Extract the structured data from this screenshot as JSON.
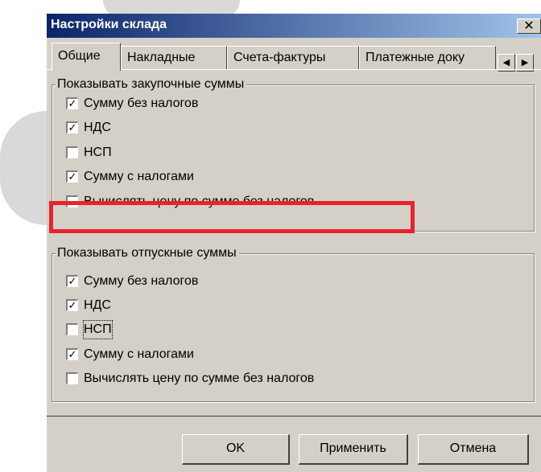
{
  "window": {
    "title": "Настройки склада",
    "close_glyph": "✕"
  },
  "tabs": [
    {
      "label": "Общие",
      "active": true
    },
    {
      "label": "Накладные",
      "active": false
    },
    {
      "label": "Счета-фактуры",
      "active": false
    },
    {
      "label": "Платежные доку",
      "active": false
    }
  ],
  "tab_scroll": {
    "left_glyph": "◀",
    "right_glyph": "▶"
  },
  "purchase_group": {
    "legend": "Показывать закупочные суммы",
    "items": [
      {
        "label": "Сумму без налогов",
        "mark": "✓",
        "checked": true
      },
      {
        "label": "НДС",
        "mark": "✓",
        "checked": true
      },
      {
        "label": "НСП",
        "mark": "",
        "checked": false
      },
      {
        "label": "Сумму с налогами",
        "mark": "✓",
        "checked": true
      },
      {
        "label": "Вычислять цену по сумме без налогов",
        "mark": "",
        "checked": false
      }
    ]
  },
  "sale_group": {
    "legend": "Показывать отпускные суммы",
    "items": [
      {
        "label": "Сумму без налогов",
        "mark": "✓",
        "checked": true
      },
      {
        "label": "НДС",
        "mark": "✓",
        "checked": true
      },
      {
        "label": "НСП",
        "mark": "",
        "checked": false
      },
      {
        "label": "Сумму с налогами",
        "mark": "✓",
        "checked": true
      },
      {
        "label": "Вычислять цену по сумме без налогов",
        "mark": "",
        "checked": false
      }
    ]
  },
  "buttons": {
    "ok": "OK",
    "apply": "Применить",
    "cancel": "Отмена"
  },
  "colors": {
    "highlight": "#e8232a",
    "titlebar_start": "#0a246a",
    "titlebar_end": "#a6caf0",
    "face": "#d4d0c8"
  }
}
